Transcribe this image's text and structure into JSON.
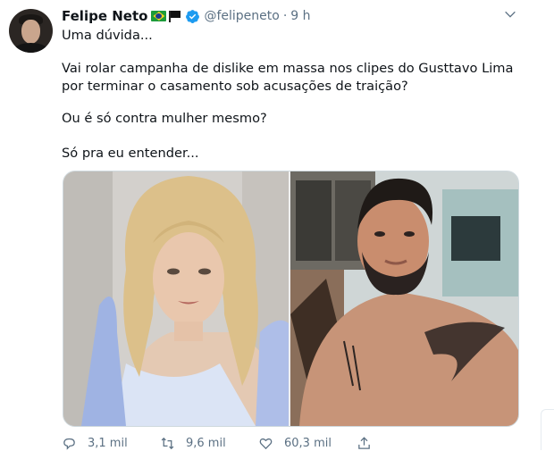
{
  "tweet": {
    "author_name": "Felipe Neto",
    "author_flags": [
      "brazil-flag-icon",
      "black-flag-icon"
    ],
    "verified": true,
    "handle": "@felipeneto",
    "separator": "·",
    "time": "9 h",
    "paragraphs": [
      "Uma dúvida...",
      "Vai rolar campanha de dislike em massa nos clipes do Gusttavo Lima por terminar o casamento sob acusações de traição?",
      "Ou é só contra mulher mesmo?",
      "Só pra eu entender..."
    ],
    "media": [
      "photo-left",
      "photo-right"
    ],
    "actions": {
      "replies": "3,1 mil",
      "retweets": "9,6 mil",
      "likes": "60,3 mil"
    }
  },
  "colors": {
    "text": "#0f1419",
    "secondary": "#5b7083",
    "verified": "#1d9bf0",
    "border": "#cfd9de"
  }
}
